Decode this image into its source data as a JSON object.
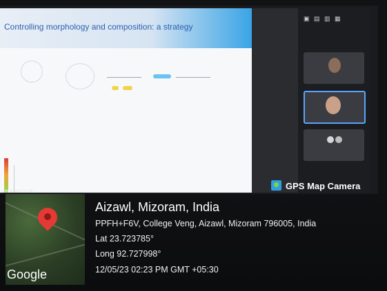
{
  "slide": {
    "title": "Controlling morphology and composition: a strategy"
  },
  "branding": {
    "university_label": "UNIVERSITY OF"
  },
  "overlay": {
    "app_label": "GPS Map Camera",
    "location_title": "Aizawl, Mizoram, India",
    "address": "PPFH+F6V, College Veng, Aizawl, Mizoram 796005, India",
    "lat": "Lat 23.723785°",
    "long": "Long 92.727998°",
    "datetime": "12/05/23 02:23 PM GMT +05:30",
    "map_logo": "Google"
  },
  "colors": {
    "pin": "#e53935",
    "accent_blue": "#3aa4e6",
    "meeting_bg": "#1c1d20"
  }
}
